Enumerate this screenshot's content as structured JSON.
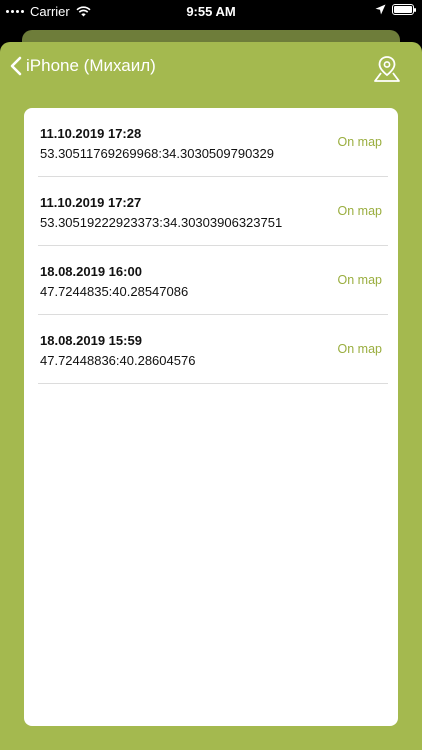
{
  "status_bar": {
    "carrier": "Carrier",
    "time": "9:55 AM"
  },
  "nav": {
    "back_label": "iPhone (Михаил)",
    "map_icon": "map-pin-icon"
  },
  "colors": {
    "accent": "#a4b94f",
    "link": "#9aae3f",
    "back_card": "#6e7d3a"
  },
  "locations": [
    {
      "datetime": "11.10.2019 17:28",
      "coords": "53.30511769269968:34.3030509790329",
      "link": "On map"
    },
    {
      "datetime": "11.10.2019 17:27",
      "coords": "53.30519222923373:34.30303906323751",
      "link": "On map"
    },
    {
      "datetime": "18.08.2019 16:00",
      "coords": "47.7244835:40.28547086",
      "link": "On map"
    },
    {
      "datetime": "18.08.2019 15:59",
      "coords": "47.72448836:40.28604576",
      "link": "On map"
    }
  ]
}
